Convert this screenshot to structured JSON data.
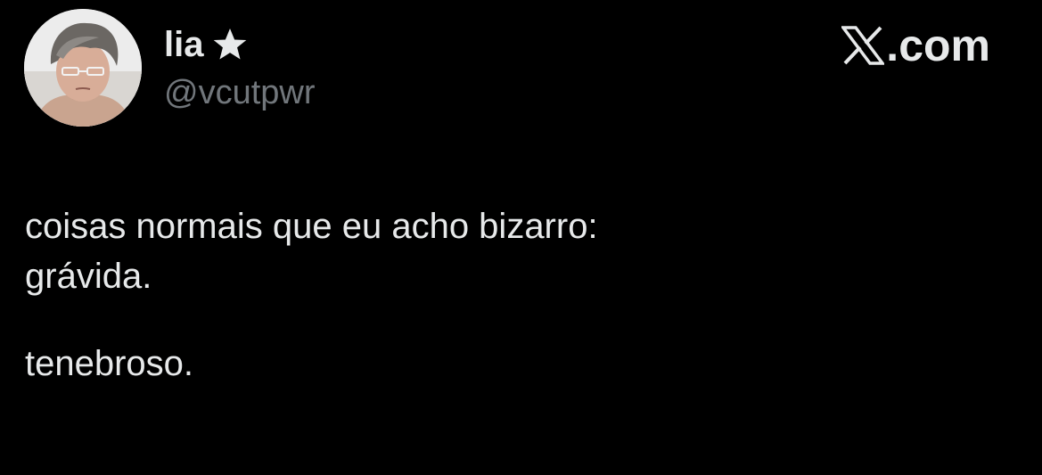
{
  "tweet": {
    "author": {
      "display_name": "lia",
      "badge_icon": "star-icon",
      "handle": "@vcutpwr",
      "avatar_icon": "avatar-photo"
    },
    "brand": {
      "logo_icon": "x-logo-icon",
      "domain": ".com"
    },
    "text_lines": [
      "coisas normais que eu acho bizarro:",
      "grávida.",
      "",
      "tenebroso."
    ],
    "colors": {
      "background": "#000000",
      "primary_text": "#e7e9ea",
      "secondary_text": "#71767b"
    }
  }
}
